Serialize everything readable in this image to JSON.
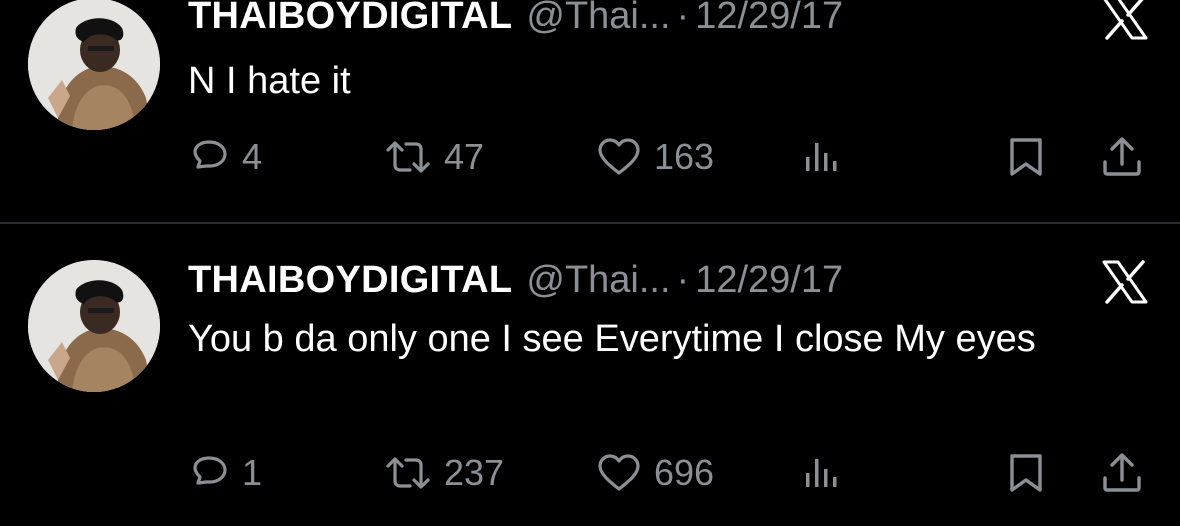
{
  "tweets": [
    {
      "display_name": "THAIBOYDIGITAL",
      "handle": "@Thai...",
      "separator": "·",
      "date": "12/29/17",
      "text": "N I hate it",
      "replies": "4",
      "retweets": "47",
      "likes": "163"
    },
    {
      "display_name": "THAIBOYDIGITAL",
      "handle": "@Thai...",
      "separator": "·",
      "date": "12/29/17",
      "text": "You b da only one I see Everytime I close My eyes",
      "replies": "1",
      "retweets": "237",
      "likes": "696"
    }
  ],
  "icons": {
    "reply": "reply-icon",
    "retweet": "retweet-icon",
    "like": "heart-icon",
    "views": "analytics-icon",
    "bookmark": "bookmark-icon",
    "share": "share-icon",
    "brand": "x-logo-icon"
  },
  "colors": {
    "background": "#000000",
    "primary_text": "#ffffff",
    "secondary_text": "#8b9096",
    "divider": "#2a2d30"
  }
}
